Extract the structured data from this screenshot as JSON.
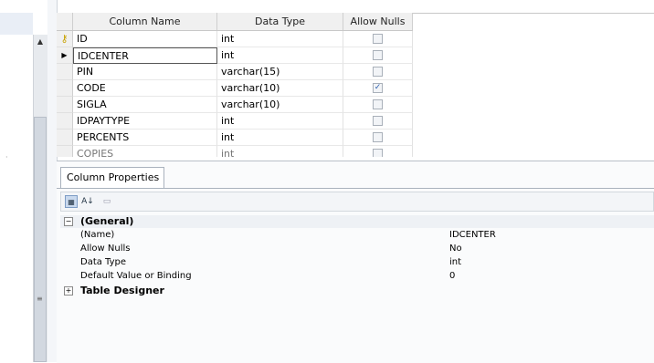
{
  "grid": {
    "headers": {
      "name": "Column Name",
      "type": "Data Type",
      "nulls": "Allow Nulls"
    },
    "rows": [
      {
        "name": "ID",
        "type": "int",
        "allow_nulls": false,
        "marker": "key-icon"
      },
      {
        "name": "IDCENTER",
        "type": "int",
        "allow_nulls": false,
        "marker": "current-row-arrow-icon"
      },
      {
        "name": "PIN",
        "type": "varchar(15)",
        "allow_nulls": false
      },
      {
        "name": "CODE",
        "type": "varchar(10)",
        "allow_nulls": true
      },
      {
        "name": "SIGLA",
        "type": "varchar(10)",
        "allow_nulls": false
      },
      {
        "name": "IDPAYTYPE",
        "type": "int",
        "allow_nulls": false
      },
      {
        "name": "PERCENTS",
        "type": "int",
        "allow_nulls": false
      },
      {
        "name": "COPIES",
        "type": "int",
        "allow_nulls": false
      }
    ]
  },
  "properties": {
    "tab_label": "Column Properties",
    "toolbar_icons": [
      "categorized-icon",
      "alphabetical-sort-icon",
      "property-pages-icon"
    ],
    "general": {
      "label": "(General)",
      "expand_glyph": "−",
      "items": [
        {
          "name": "(Name)",
          "value": "IDCENTER"
        },
        {
          "name": "Allow Nulls",
          "value": "No"
        },
        {
          "name": "Data Type",
          "value": "int"
        },
        {
          "name": "Default Value or Binding",
          "value": "0"
        }
      ]
    },
    "table_designer": {
      "label": "Table Designer",
      "expand_glyph": "+"
    }
  }
}
